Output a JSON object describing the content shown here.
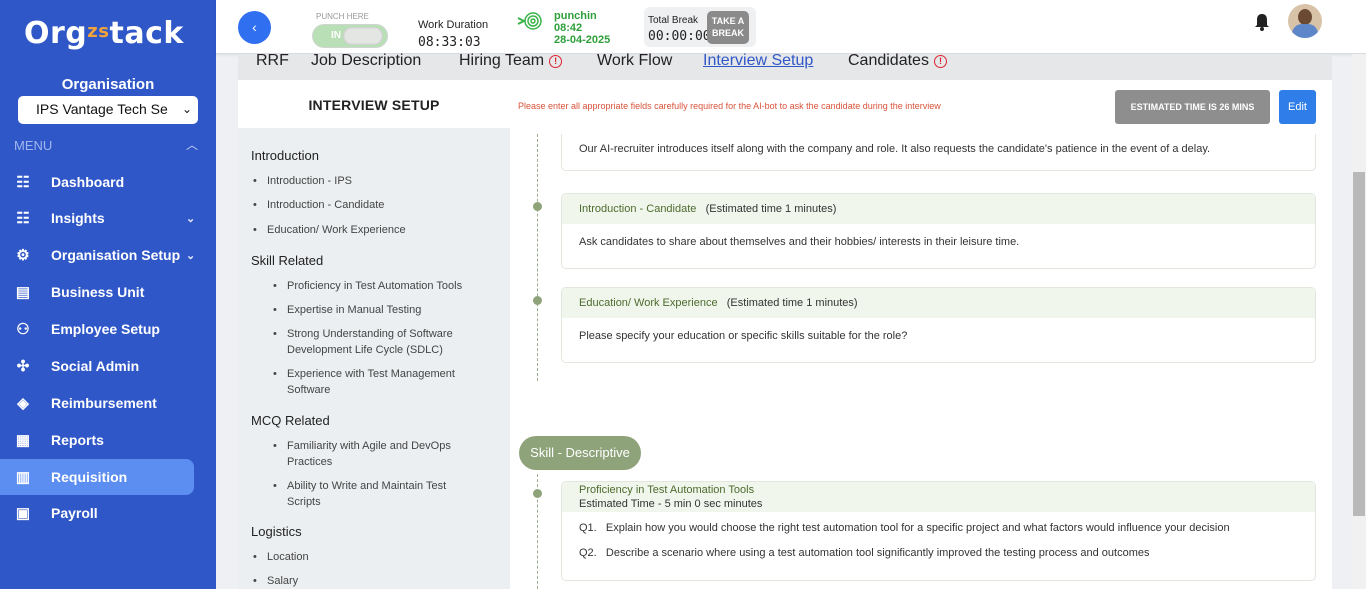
{
  "brand": {
    "logo_text_1": "Org",
    "logo_text_2": "zs",
    "logo_text_3": "tack"
  },
  "sidebar": {
    "organisation_label": "Organisation",
    "organisation_value": "IPS Vantage Tech Se",
    "menu_label": "MENU",
    "items": [
      {
        "label": "Dashboard",
        "icon": "dashboard-icon",
        "glyph": "☷"
      },
      {
        "label": "Insights",
        "icon": "insights-icon",
        "glyph": "☷"
      },
      {
        "label": "Organisation Setup",
        "icon": "organisation-setup-icon",
        "glyph": "⚙"
      },
      {
        "label": "Business Unit",
        "icon": "briefcase-icon",
        "glyph": "💼"
      },
      {
        "label": "Employee Setup",
        "icon": "employee-icon",
        "glyph": "👥"
      },
      {
        "label": "Social Admin",
        "icon": "social-admin-icon",
        "glyph": "✣"
      },
      {
        "label": "Reimbursement",
        "icon": "reimbursement-icon",
        "glyph": "$"
      },
      {
        "label": "Reports",
        "icon": "reports-icon",
        "glyph": "▦"
      },
      {
        "label": "Requisition",
        "icon": "requisition-icon",
        "glyph": "▥"
      },
      {
        "label": "Payroll",
        "icon": "payroll-icon",
        "glyph": "▣"
      }
    ]
  },
  "topbar": {
    "punch_label": "PUNCH HERE",
    "punch_state": "IN",
    "work_duration_label": "Work Duration",
    "work_duration_value": "08:33:03",
    "punchin_label": "punchin",
    "punchin_time": "08:42",
    "punchin_date": "28-04-2025",
    "total_break_label": "Total Break",
    "total_break_value": "00:00:00",
    "take_break_label_1": "TAKE A",
    "take_break_label_2": "BREAK"
  },
  "tabs": [
    {
      "label": "RRF"
    },
    {
      "label": "Job Description"
    },
    {
      "label": "Hiring Team"
    },
    {
      "label": "Work Flow"
    },
    {
      "label": "Interview Setup"
    },
    {
      "label": "Candidates"
    }
  ],
  "outline": {
    "title": "INTERVIEW SETUP",
    "sections": [
      {
        "title": "Introduction",
        "items": [
          "Introduction - IPS",
          "Introduction - Candidate",
          "Education/ Work Experience"
        ]
      },
      {
        "title": "Skill Related",
        "items": [
          "Proficiency in Test Automation Tools",
          "Expertise in Manual Testing",
          "Strong Understanding of Software Development Life Cycle (SDLC)",
          "Experience with Test Management Software"
        ]
      },
      {
        "title": "MCQ Related",
        "items": [
          "Familiarity with Agile and DevOps Practices",
          "Ability to Write and Maintain Test Scripts"
        ]
      },
      {
        "title": "Logistics",
        "items": [
          "Location",
          "Salary"
        ]
      }
    ]
  },
  "main": {
    "notice": "Please enter all appropriate fields carefully required for the AI-bot to ask the candidate during the interview",
    "estimated_time_label": "ESTIMATED TIME IS 26 MINS",
    "edit_label": "Edit",
    "partial_text": "Our AI-recruiter introduces itself along with the company and role. It also requests the candidate's patience in the event of a delay.",
    "intro_cards": [
      {
        "title": "Introduction - Candidate",
        "time": "(Estimated time 1 minutes)",
        "body": "Ask candidates to share about themselves and their hobbies/ interests in their leisure time."
      },
      {
        "title": "Education/ Work Experience",
        "time": "(Estimated time 1 minutes)",
        "body": "Please specify your education or specific skills suitable for the role?"
      }
    ],
    "skill_section_label": "Skill - Descriptive",
    "skill_card": {
      "title": "Proficiency in Test Automation Tools",
      "time": "Estimated Time - 5 min 0 sec minutes",
      "questions": [
        {
          "num": "Q1.",
          "text": "Explain how you would choose the right test automation tool for a specific project and what factors would influence your decision"
        },
        {
          "num": "Q2.",
          "text": "Describe a scenario where using a test automation tool significantly improved the testing process and outcomes"
        }
      ]
    }
  },
  "colors": {
    "sidebar": "#2f57c8",
    "active_nav": "#5b8ef0",
    "accent_green": "#8ea37a",
    "warning": "#d23333"
  }
}
